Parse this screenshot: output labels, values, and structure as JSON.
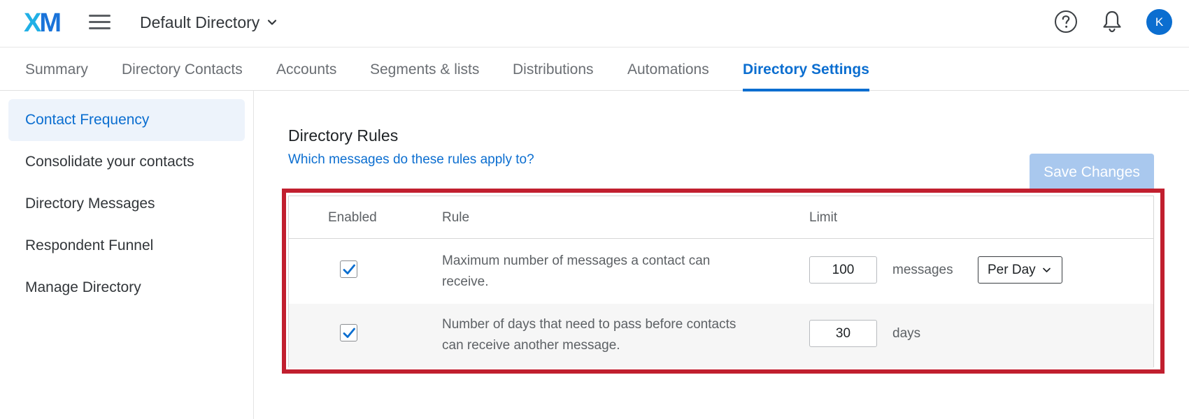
{
  "header": {
    "logo": {
      "x": "X",
      "m": "M"
    },
    "directory_name": "Default Directory",
    "avatar_initial": "K"
  },
  "tabs": [
    {
      "label": "Summary"
    },
    {
      "label": "Directory Contacts"
    },
    {
      "label": "Accounts"
    },
    {
      "label": "Segments & lists"
    },
    {
      "label": "Distributions"
    },
    {
      "label": "Automations"
    },
    {
      "label": "Directory Settings",
      "active": true
    }
  ],
  "sidebar": {
    "items": [
      {
        "label": "Contact Frequency",
        "active": true
      },
      {
        "label": "Consolidate your contacts"
      },
      {
        "label": "Directory Messages"
      },
      {
        "label": "Respondent Funnel"
      },
      {
        "label": "Manage Directory"
      }
    ]
  },
  "main": {
    "title": "Directory Rules",
    "rules_link": "Which messages do these rules apply to?",
    "save_label": "Save Changes",
    "table": {
      "headers": {
        "enabled": "Enabled",
        "rule": "Rule",
        "limit": "Limit"
      },
      "rows": [
        {
          "enabled": true,
          "rule_line1": "Maximum number of messages a contact can",
          "rule_line2": "receive.",
          "limit_value": "100",
          "unit": "messages",
          "period": "Per Day"
        },
        {
          "enabled": true,
          "rule_line1": "Number of days that need to pass before contacts",
          "rule_line2": "can receive another message.",
          "limit_value": "30",
          "unit": "days"
        }
      ]
    }
  },
  "colors": {
    "accent": "#0b6ed0",
    "highlight_frame": "#c11f2f",
    "save_disabled": "#a9c8ee"
  }
}
